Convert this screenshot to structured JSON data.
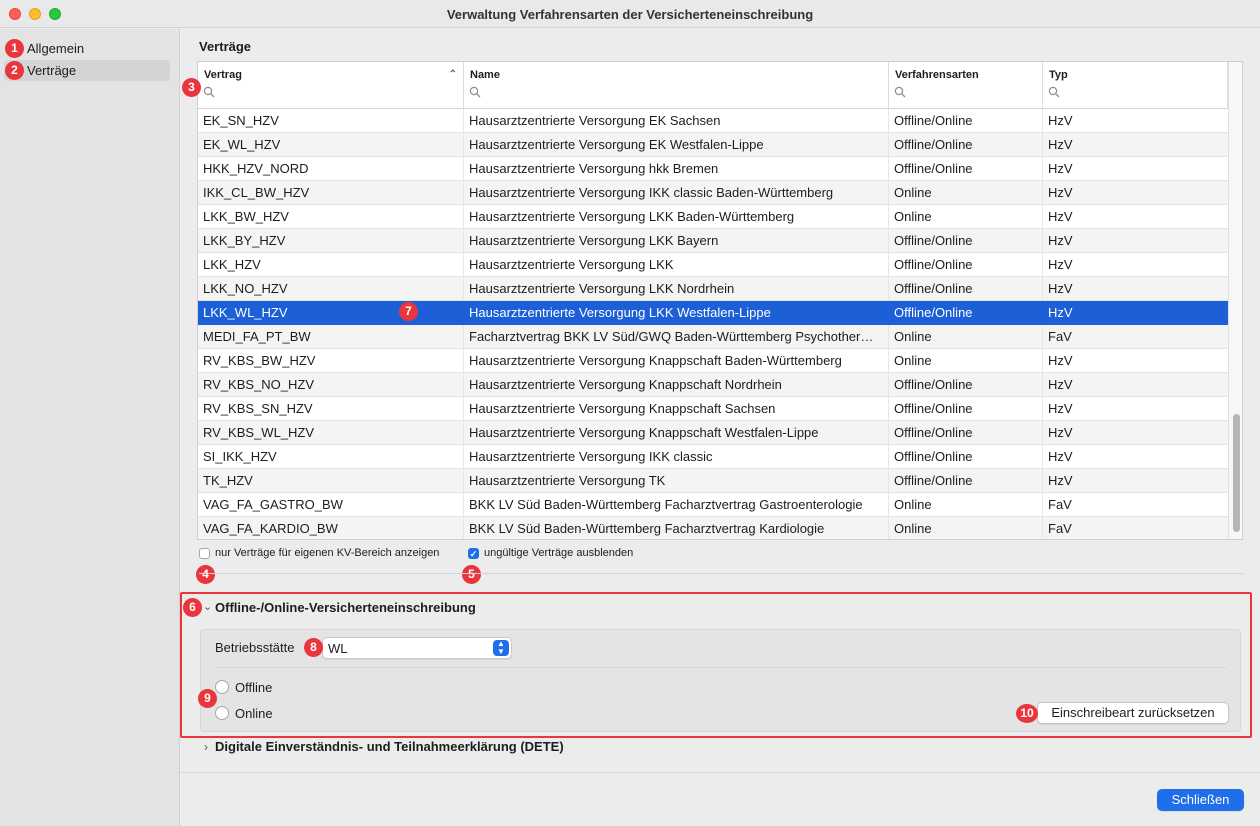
{
  "window": {
    "title": "Verwaltung Verfahrensarten der Versicherteneinschreibung"
  },
  "sidebar": {
    "items": [
      {
        "label": "Allgemein",
        "badge": "1"
      },
      {
        "label": "Verträge",
        "badge": "2"
      }
    ]
  },
  "contracts": {
    "title": "Verträge",
    "columns": [
      "Vertrag",
      "Name",
      "Verfahrensarten",
      "Typ"
    ],
    "header_badge": "3",
    "rows": [
      [
        "EK_SN_HZV",
        "Hausarztzentrierte Versorgung EK Sachsen",
        "Offline/Online",
        "HzV"
      ],
      [
        "EK_WL_HZV",
        "Hausarztzentrierte Versorgung EK Westfalen-Lippe",
        "Offline/Online",
        "HzV"
      ],
      [
        "HKK_HZV_NORD",
        "Hausarztzentrierte Versorgung hkk Bremen",
        "Offline/Online",
        "HzV"
      ],
      [
        "IKK_CL_BW_HZV",
        "Hausarztzentrierte Versorgung IKK classic Baden-Württemberg",
        "Online",
        "HzV"
      ],
      [
        "LKK_BW_HZV",
        "Hausarztzentrierte Versorgung LKK Baden-Württemberg",
        "Online",
        "HzV"
      ],
      [
        "LKK_BY_HZV",
        "Hausarztzentrierte Versorgung LKK Bayern",
        "Offline/Online",
        "HzV"
      ],
      [
        "LKK_HZV",
        "Hausarztzentrierte Versorgung LKK",
        "Offline/Online",
        "HzV"
      ],
      [
        "LKK_NO_HZV",
        "Hausarztzentrierte Versorgung LKK Nordrhein",
        "Offline/Online",
        "HzV"
      ],
      [
        "LKK_WL_HZV",
        "Hausarztzentrierte Versorgung LKK Westfalen-Lippe",
        "Offline/Online",
        "HzV"
      ],
      [
        "MEDI_FA_PT_BW",
        "Facharztvertrag BKK LV Süd/GWQ Baden-Württemberg Psychother…",
        "Online",
        "FaV"
      ],
      [
        "RV_KBS_BW_HZV",
        "Hausarztzentrierte Versorgung Knappschaft Baden-Württemberg",
        "Online",
        "HzV"
      ],
      [
        "RV_KBS_NO_HZV",
        "Hausarztzentrierte Versorgung Knappschaft Nordrhein",
        "Offline/Online",
        "HzV"
      ],
      [
        "RV_KBS_SN_HZV",
        "Hausarztzentrierte Versorgung Knappschaft Sachsen",
        "Offline/Online",
        "HzV"
      ],
      [
        "RV_KBS_WL_HZV",
        "Hausarztzentrierte Versorgung Knappschaft Westfalen-Lippe",
        "Offline/Online",
        "HzV"
      ],
      [
        "SI_IKK_HZV",
        "Hausarztzentrierte Versorgung IKK classic",
        "Offline/Online",
        "HzV"
      ],
      [
        "TK_HZV",
        "Hausarztzentrierte Versorgung TK",
        "Offline/Online",
        "HzV"
      ],
      [
        "VAG_FA_GASTRO_BW",
        "BKK LV Süd Baden-Württemberg Facharztvertrag Gastroenterologie",
        "Online",
        "FaV"
      ],
      [
        "VAG_FA_KARDIO_BW",
        "BKK LV Süd Baden-Württemberg Facharztvertrag Kardiologie",
        "Online",
        "FaV"
      ]
    ],
    "selected_row_index": 8,
    "selected_badge": "7"
  },
  "filters": {
    "own_kv_label": "nur Verträge für eigenen KV-Bereich anzeigen",
    "own_kv_checked": false,
    "own_kv_badge": "4",
    "hide_invalid_label": "ungültige Verträge ausblenden",
    "hide_invalid_checked": true,
    "hide_invalid_badge": "5"
  },
  "enrollment": {
    "title": "Offline-/Online-Versicherteneinschreibung",
    "badge": "6",
    "betriebsstaette_label": "Betriebsstätte",
    "betriebsstaette_badge": "8",
    "betriebsstaette_value": "WL",
    "options": [
      "Offline",
      "Online"
    ],
    "options_badge": "9",
    "reset_label": "Einschreibeart zurücksetzen",
    "reset_badge": "10"
  },
  "dete": {
    "title": "Digitale Einverständnis- und Teilnahmeerklärung (DETE)"
  },
  "footer": {
    "close_label": "Schließen"
  },
  "colors": {
    "accent": "#1f6feb",
    "selection": "#1c5fd6",
    "badge": "#e8363c"
  }
}
